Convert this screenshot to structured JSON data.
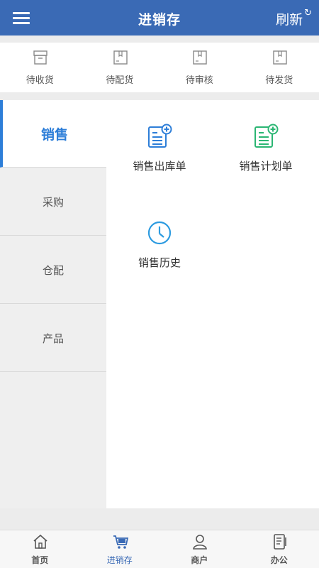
{
  "header": {
    "title": "进销存",
    "refresh_label": "刷新",
    "refresh_icon": "refresh-icon",
    "menu_icon": "menu-icon"
  },
  "status": [
    {
      "label": "待收货",
      "icon": "inbox-icon"
    },
    {
      "label": "待配货",
      "icon": "package-icon"
    },
    {
      "label": "待审核",
      "icon": "package-icon"
    },
    {
      "label": "待发货",
      "icon": "package-icon"
    }
  ],
  "sidebar": {
    "active": "销售",
    "items": [
      {
        "label": "销售"
      },
      {
        "label": "采购"
      },
      {
        "label": "仓配"
      },
      {
        "label": "产品"
      }
    ]
  },
  "content": {
    "tiles": [
      {
        "label": "销售出库单",
        "icon": "outbound-doc-icon",
        "color": "#2d7ed8"
      },
      {
        "label": "销售计划单",
        "icon": "plan-doc-icon",
        "color": "#2bb673"
      },
      {
        "label": "销售历史",
        "icon": "clock-icon",
        "color": "#2d9be0"
      }
    ]
  },
  "tabbar": {
    "active": "进销存",
    "tabs": [
      {
        "label": "首页",
        "icon": "home-icon"
      },
      {
        "label": "进销存",
        "icon": "cart-icon"
      },
      {
        "label": "商户",
        "icon": "user-icon"
      },
      {
        "label": "办公",
        "icon": "office-doc-icon"
      }
    ]
  },
  "colors": {
    "primary": "#3a6ab5",
    "active_blue": "#2d7ed8",
    "green": "#2bb673"
  }
}
